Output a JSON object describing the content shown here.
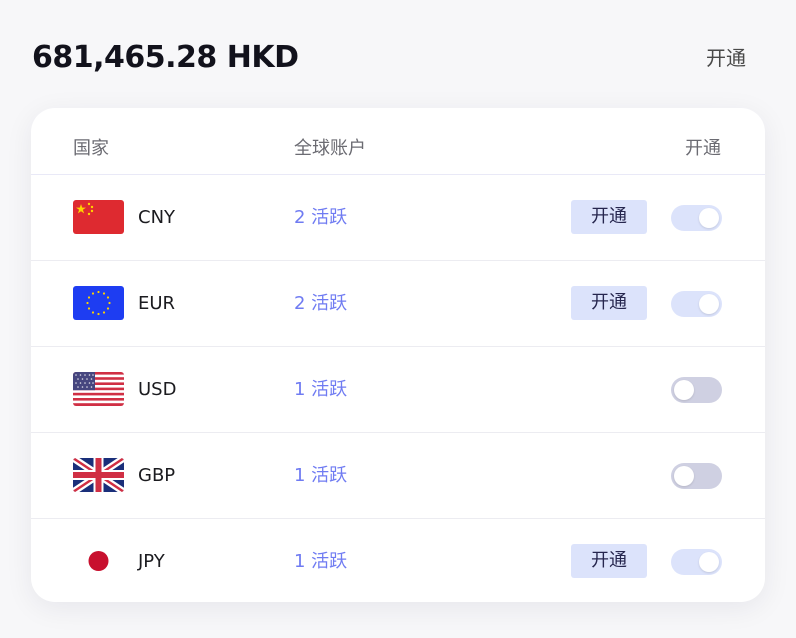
{
  "header": {
    "balance": "681,465.28 HKD",
    "open_label": "开通"
  },
  "table": {
    "columns": {
      "country": "国家",
      "account": "全球账户",
      "open": "开通"
    },
    "rows": [
      {
        "currency": "CNY",
        "flag": "china-flag-icon",
        "active": "2 活跃",
        "open_button": "开通",
        "toggle_on": true
      },
      {
        "currency": "EUR",
        "flag": "eu-flag-icon",
        "active": "2 活跃",
        "open_button": "开通",
        "toggle_on": true
      },
      {
        "currency": "USD",
        "flag": "us-flag-icon",
        "active": "1 活跃",
        "open_button": null,
        "toggle_on": false
      },
      {
        "currency": "GBP",
        "flag": "uk-flag-icon",
        "active": "1 活跃",
        "open_button": null,
        "toggle_on": false
      },
      {
        "currency": "JPY",
        "flag": "japan-flag-icon",
        "active": "1 活跃",
        "open_button": "开通",
        "toggle_on": true
      }
    ]
  },
  "colors": {
    "active_text": "#6f7bf2",
    "button_bg": "#dce3fb",
    "toggle_on": "#dce3fb",
    "toggle_off": "#cfd0e2"
  }
}
